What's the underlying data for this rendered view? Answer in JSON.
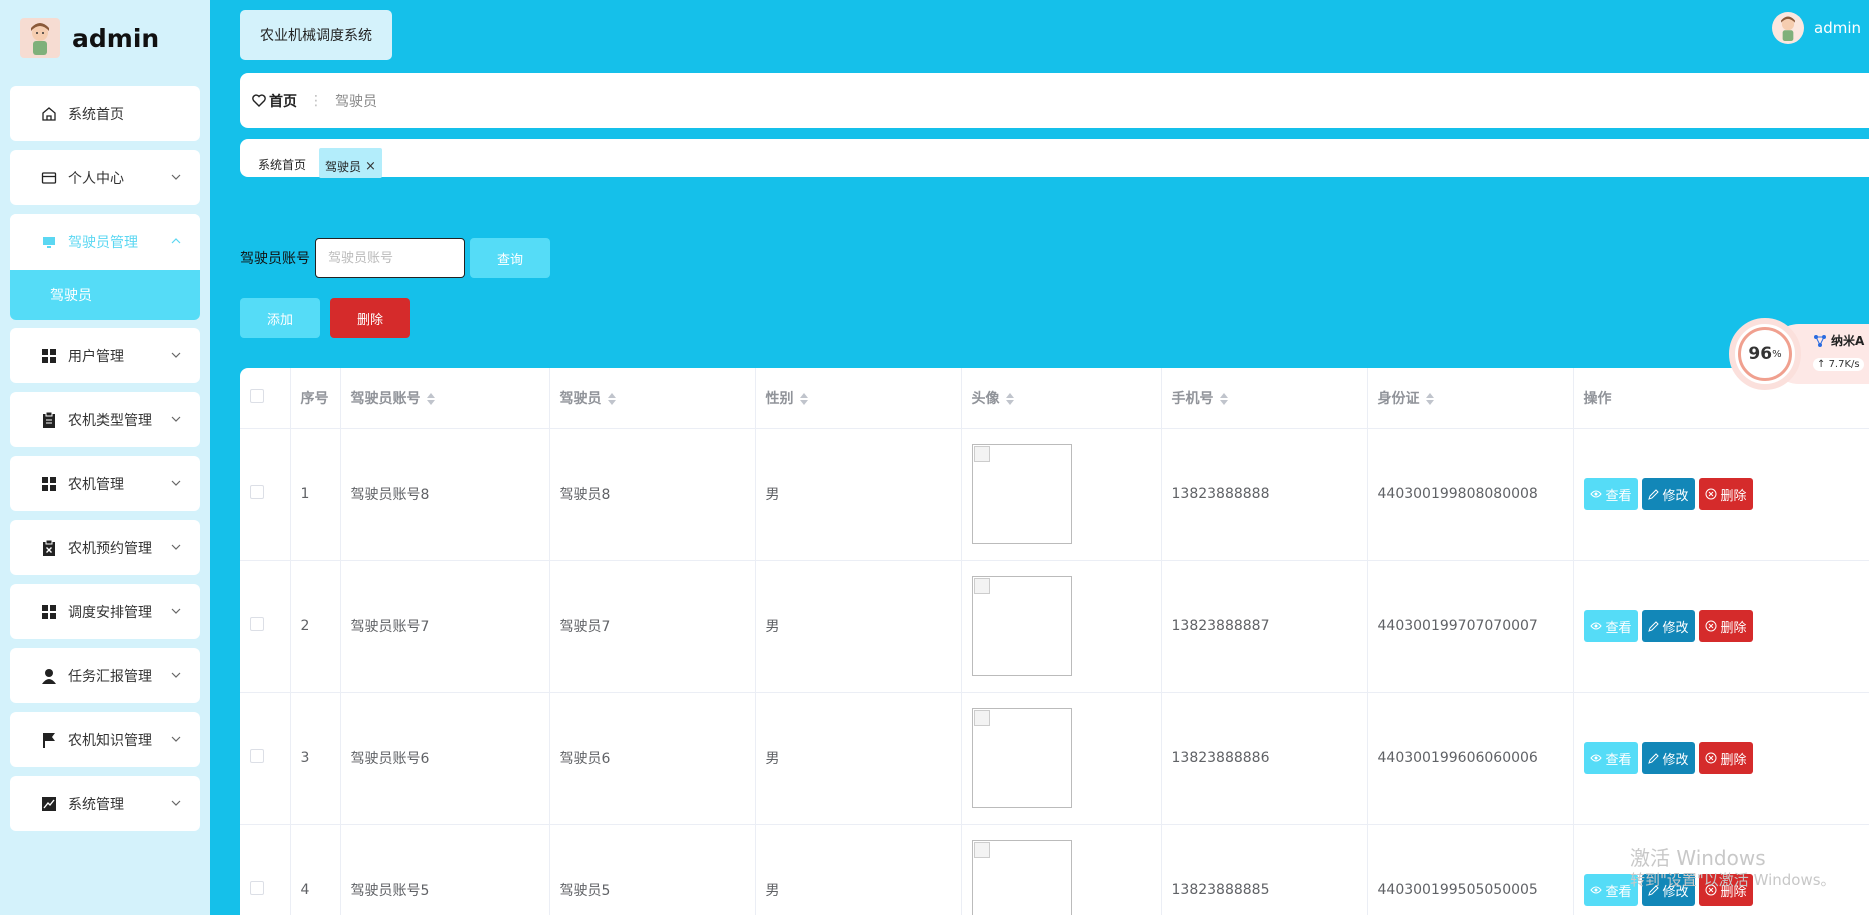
{
  "brand": {
    "title": "admin"
  },
  "sidebar": {
    "items": [
      {
        "label": "系统首页",
        "icon": "home-icon"
      },
      {
        "label": "个人中心",
        "icon": "wallet-icon"
      },
      {
        "label": "驾驶员管理",
        "icon": "monitor-icon"
      },
      {
        "label": "用户管理",
        "icon": "grid-icon"
      },
      {
        "label": "农机类型管理",
        "icon": "clipboard-icon"
      },
      {
        "label": "农机管理",
        "icon": "grid-icon"
      },
      {
        "label": "农机预约管理",
        "icon": "doc-x-icon"
      },
      {
        "label": "调度安排管理",
        "icon": "grid-icon"
      },
      {
        "label": "任务汇报管理",
        "icon": "user-icon"
      },
      {
        "label": "农机知识管理",
        "icon": "flag-icon"
      },
      {
        "label": "系统管理",
        "icon": "chart-icon"
      }
    ],
    "submenu": {
      "label": "驾驶员"
    }
  },
  "header": {
    "system_title": "农业机械调度系统",
    "user": "admin"
  },
  "breadcrumb": {
    "home": "首页",
    "current": "驾驶员"
  },
  "tags": {
    "home": "系统首页",
    "active": "驾驶员"
  },
  "search": {
    "label": "驾驶员账号",
    "placeholder": "驾驶员账号",
    "query_button": "查询"
  },
  "actions": {
    "add": "添加",
    "delete": "删除"
  },
  "widget": {
    "percent": "96",
    "unit": "%",
    "name": "纳米A",
    "speed": "7.7K/s"
  },
  "table": {
    "headers": [
      "序号",
      "驾驶员账号",
      "驾驶员",
      "性别",
      "头像",
      "手机号",
      "身份证",
      "操作"
    ],
    "rows": [
      {
        "index": "1",
        "account": "驾驶员账号8",
        "name": "驾驶员8",
        "gender": "男",
        "phone": "13823888888",
        "idcard": "440300199808080008"
      },
      {
        "index": "2",
        "account": "驾驶员账号7",
        "name": "驾驶员7",
        "gender": "男",
        "phone": "13823888887",
        "idcard": "440300199707070007"
      },
      {
        "index": "3",
        "account": "驾驶员账号6",
        "name": "驾驶员6",
        "gender": "男",
        "phone": "13823888886",
        "idcard": "440300199606060006"
      },
      {
        "index": "4",
        "account": "驾驶员账号5",
        "name": "驾驶员5",
        "gender": "男",
        "phone": "13823888885",
        "idcard": "440300199505050005"
      }
    ],
    "ops": {
      "view": "查看",
      "edit": "修改",
      "delete": "删除"
    }
  },
  "watermark": {
    "line1": "激活 Windows",
    "line2": "转到\"设置\"以激活 Windows。"
  }
}
